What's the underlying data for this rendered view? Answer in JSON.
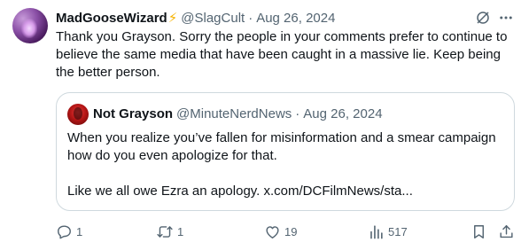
{
  "post": {
    "author_name": "MadGooseWizard",
    "author_badge": "⚡",
    "handle": "@SlagCult",
    "separator": "·",
    "date": "Aug 26, 2024",
    "text": "Thank you Grayson. Sorry the people in your comments prefer to continue to believe the same media that have been caught in a massive lie. Keep being the better person."
  },
  "quote": {
    "author_name": "Not Grayson",
    "handle": "@MinuteNerdNews",
    "separator": "·",
    "date": "Aug 26, 2024",
    "line1": "When you realize you’ve fallen for misinformation and a smear campaign how do you even apologize for that.",
    "line2": "Like we all owe Ezra an apology. x.com/DCFilmNews/sta..."
  },
  "actions": {
    "replies": "1",
    "reposts": "1",
    "likes": "19",
    "views": "517"
  },
  "colors": {
    "text": "#0f1419",
    "muted": "#536471",
    "border": "#cfd9de",
    "bolt": "#f6b200"
  },
  "icons": [
    "grok-icon",
    "more-icon",
    "reply-icon",
    "repost-icon",
    "like-icon",
    "views-icon",
    "bookmark-icon",
    "share-icon"
  ]
}
